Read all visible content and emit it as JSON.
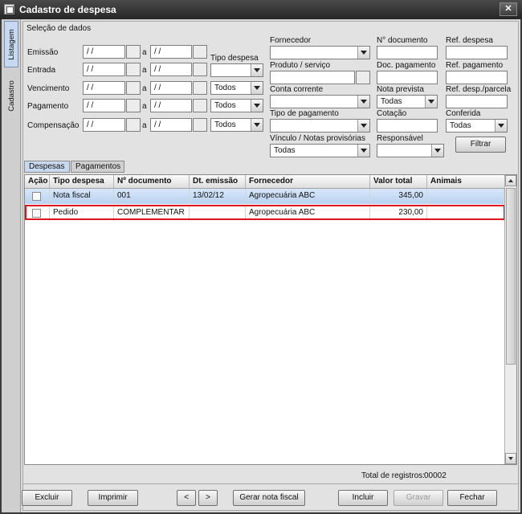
{
  "window": {
    "title": "Cadastro de despesa",
    "close_label": "✕"
  },
  "side_tabs": [
    {
      "label": "Listagem"
    },
    {
      "label": "Cadastro"
    }
  ],
  "filters": {
    "section_label": "Seleção de dados",
    "date_rows": [
      {
        "label": "Emissão",
        "from": "/ /",
        "to": "/ /",
        "sep": "a"
      },
      {
        "label": "Entrada",
        "from": "/ /",
        "to": "/ /",
        "sep": "a"
      },
      {
        "label": "Vencimento",
        "from": "/ /",
        "to": "/ /",
        "sep": "a"
      },
      {
        "label": "Pagamento",
        "from": "/ /",
        "to": "/ /",
        "sep": "a"
      },
      {
        "label": "Compensação",
        "from": "/ /",
        "to": "/ /",
        "sep": "a"
      }
    ],
    "tipo_despesa_label": "Tipo despesa",
    "tipo_despesa_value": "",
    "todos_values": [
      "Todos",
      "Todos",
      "Todos"
    ],
    "fornecedor_label": "Fornecedor",
    "fornecedor_value": "",
    "produto_label": "Produto / serviço",
    "produto_value": "",
    "conta_label": "Conta corrente",
    "conta_value": "",
    "tipo_pagamento_label": "Tipo de pagamento",
    "tipo_pagamento_value": "",
    "vinculo_label": "Vínculo / Notas provisórias",
    "vinculo_value": "Todas",
    "ndoc_label": "N° documento",
    "ndoc_value": "",
    "doc_pagamento_label": "Doc. pagamento",
    "doc_pagamento_value": "",
    "nota_prevista_label": "Nota prevista",
    "nota_prevista_value": "Todas",
    "cotacao_label": "Cotação",
    "cotacao_value": "",
    "responsavel_label": "Responsável",
    "responsavel_value": "",
    "ref_despesa_label": "Ref. despesa",
    "ref_despesa_value": "",
    "ref_pagamento_label": "Ref. pagamento",
    "ref_pagamento_value": "",
    "ref_parcela_label": "Ref. desp./parcela",
    "ref_parcela_value": "",
    "conferida_label": "Conferida",
    "conferida_value": "Todas",
    "filter_button": "Filtrar"
  },
  "tabs": [
    {
      "label": "Despesas"
    },
    {
      "label": "Pagamentos"
    }
  ],
  "table": {
    "columns": [
      "Ação",
      "Tipo despesa",
      "Nº documento",
      "Dt. emissão",
      "Fornecedor",
      "Valor total",
      "Animais"
    ],
    "rows": [
      {
        "tipo": "Nota fiscal",
        "ndoc": "001",
        "dt": "13/02/12",
        "fornecedor": "Agropecuária ABC",
        "valor": "345,00",
        "animais": ""
      },
      {
        "tipo": "Pedido",
        "ndoc": "COMPLEMENTAR",
        "dt": "",
        "fornecedor": "Agropecuária ABC",
        "valor": "230,00",
        "animais": ""
      }
    ],
    "total_label": "Total de registros:",
    "total_value": "00002"
  },
  "footer": {
    "excluir": "Excluir",
    "imprimir": "Imprimir",
    "prev": "<",
    "next": ">",
    "gerar": "Gerar nota fiscal",
    "incluir": "Incluir",
    "gravar": "Gravar",
    "fechar": "Fechar"
  }
}
